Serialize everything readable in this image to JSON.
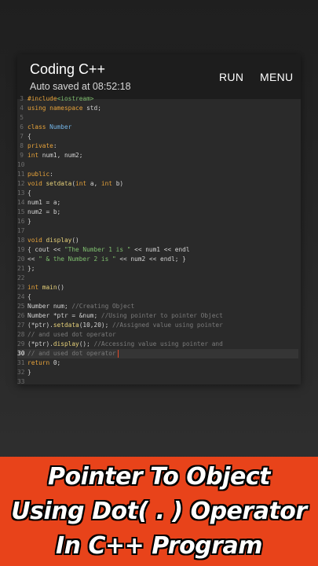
{
  "app": {
    "title": "Coding C++",
    "subtitle": "Auto saved at 08:52:18",
    "run_label": "RUN",
    "menu_label": "MENU"
  },
  "editor": {
    "current_line": 30,
    "lines": [
      {
        "n": "3",
        "tokens": [
          [
            "kw",
            "#include"
          ],
          [
            "str",
            "<iostream>"
          ]
        ]
      },
      {
        "n": "4",
        "tokens": [
          [
            "kw",
            "using namespace"
          ],
          [
            "plain",
            " std;"
          ]
        ]
      },
      {
        "n": "5",
        "tokens": []
      },
      {
        "n": "6",
        "tokens": [
          [
            "kw",
            "class "
          ],
          [
            "typ",
            "Number"
          ]
        ]
      },
      {
        "n": "7",
        "tokens": [
          [
            "plain",
            "{"
          ]
        ]
      },
      {
        "n": "8",
        "tokens": [
          [
            "kw",
            "private"
          ],
          [
            "plain",
            ":"
          ]
        ]
      },
      {
        "n": "9",
        "tokens": [
          [
            "kw",
            "int"
          ],
          [
            "plain",
            " num1, num2;"
          ]
        ]
      },
      {
        "n": "10",
        "tokens": []
      },
      {
        "n": "11",
        "tokens": [
          [
            "kw",
            "public"
          ],
          [
            "plain",
            ":"
          ]
        ]
      },
      {
        "n": "12",
        "tokens": [
          [
            "kw",
            "void "
          ],
          [
            "fn",
            "setdata"
          ],
          [
            "plain",
            "("
          ],
          [
            "kw",
            "int"
          ],
          [
            "plain",
            " a, "
          ],
          [
            "kw",
            "int"
          ],
          [
            "plain",
            " b)"
          ]
        ]
      },
      {
        "n": "13",
        "tokens": [
          [
            "plain",
            "{"
          ]
        ]
      },
      {
        "n": "14",
        "tokens": [
          [
            "plain",
            "num1 = a;"
          ]
        ]
      },
      {
        "n": "15",
        "tokens": [
          [
            "plain",
            "num2 = b;"
          ]
        ]
      },
      {
        "n": "16",
        "tokens": [
          [
            "plain",
            "}"
          ]
        ]
      },
      {
        "n": "17",
        "tokens": []
      },
      {
        "n": "18",
        "tokens": [
          [
            "kw",
            "void "
          ],
          [
            "fn",
            "display"
          ],
          [
            "plain",
            "()"
          ]
        ]
      },
      {
        "n": "19",
        "tokens": [
          [
            "plain",
            "{ cout << "
          ],
          [
            "str",
            "\"The Number 1 is \""
          ],
          [
            "plain",
            " << num1 << endl"
          ]
        ]
      },
      {
        "n": "20",
        "tokens": [
          [
            "plain",
            "<< "
          ],
          [
            "str",
            "\" & the Number 2 is \""
          ],
          [
            "plain",
            " << num2 << endl; }"
          ]
        ]
      },
      {
        "n": "21",
        "tokens": [
          [
            "plain",
            "};"
          ]
        ]
      },
      {
        "n": "22",
        "tokens": []
      },
      {
        "n": "23",
        "tokens": [
          [
            "kw",
            "int "
          ],
          [
            "fn",
            "main"
          ],
          [
            "plain",
            "()"
          ]
        ]
      },
      {
        "n": "24",
        "tokens": [
          [
            "plain",
            "{"
          ]
        ]
      },
      {
        "n": "25",
        "tokens": [
          [
            "plain",
            "Number num; "
          ],
          [
            "cmt",
            "//Creating Object"
          ]
        ]
      },
      {
        "n": "26",
        "tokens": [
          [
            "plain",
            "Number *ptr = &num; "
          ],
          [
            "cmt",
            "//Using pointer to pointer Object"
          ]
        ]
      },
      {
        "n": "27",
        "tokens": [
          [
            "plain",
            "(*ptr)."
          ],
          [
            "fn",
            "setdata"
          ],
          [
            "plain",
            "(10,20); "
          ],
          [
            "cmt",
            "//Assigned value using pointer"
          ]
        ]
      },
      {
        "n": "28",
        "tokens": [
          [
            "cmt",
            "// and used dot operator"
          ]
        ]
      },
      {
        "n": "29",
        "tokens": [
          [
            "plain",
            "(*ptr)."
          ],
          [
            "fn",
            "display"
          ],
          [
            "plain",
            "(); "
          ],
          [
            "cmt",
            "//Accessing value using pointer and"
          ]
        ]
      },
      {
        "n": "30",
        "tokens": [
          [
            "cmt",
            "// and used dot operator"
          ]
        ]
      },
      {
        "n": "31",
        "tokens": [
          [
            "kw",
            "return"
          ],
          [
            "plain",
            " 0;"
          ]
        ]
      },
      {
        "n": "32",
        "tokens": [
          [
            "plain",
            "}"
          ]
        ]
      },
      {
        "n": "33",
        "tokens": []
      }
    ]
  },
  "banner": {
    "line1": "Pointer To Object",
    "line2": "Using Dot( . ) Operator",
    "line3": "In C++ Program",
    "color": "#e8431a"
  }
}
